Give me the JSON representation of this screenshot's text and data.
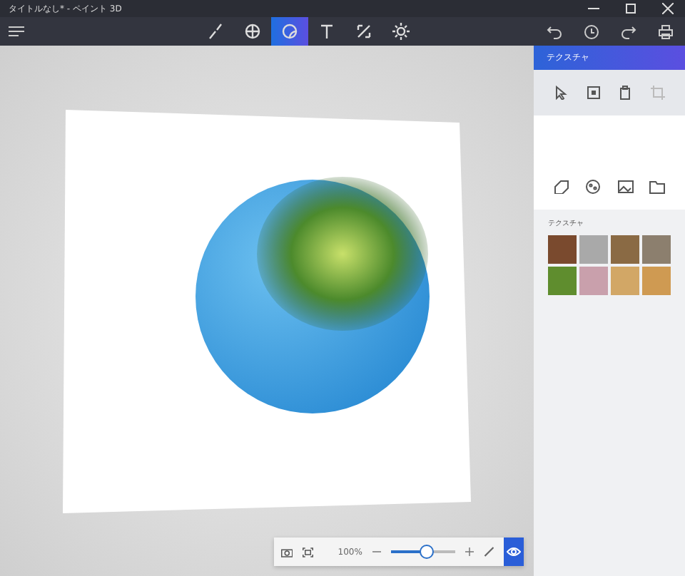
{
  "window": {
    "title": "タイトルなし* - ペイント 3D"
  },
  "tools": [
    {
      "kind": "brush",
      "selected": false
    },
    {
      "kind": "shapes3d",
      "selected": false
    },
    {
      "kind": "stickers",
      "selected": true
    },
    {
      "kind": "text",
      "selected": false
    },
    {
      "kind": "effects",
      "selected": false
    },
    {
      "kind": "canvas",
      "selected": false
    }
  ],
  "panel": {
    "title": "テクスチャ",
    "actions": [
      {
        "kind": "pointer",
        "disabled": false
      },
      {
        "kind": "select",
        "disabled": false
      },
      {
        "kind": "paste",
        "disabled": false
      },
      {
        "kind": "crop",
        "disabled": true
      }
    ],
    "categories": [
      {
        "kind": "sticker"
      },
      {
        "kind": "texture"
      },
      {
        "kind": "image"
      },
      {
        "kind": "folder"
      }
    ],
    "section_label": "テクスチャ",
    "textures": [
      {
        "color": "#7a4a2e"
      },
      {
        "color": "#a9a9a9"
      },
      {
        "color": "#8a6a44"
      },
      {
        "color": "#8c7f6e"
      },
      {
        "color": "#5f8d2e"
      },
      {
        "color": "#c9a0ac"
      },
      {
        "color": "#d2a766"
      },
      {
        "color": "#cf9a52"
      }
    ]
  },
  "zoom_bar": {
    "zoom": "100%",
    "level": 0.55,
    "view_3d_on": true
  }
}
